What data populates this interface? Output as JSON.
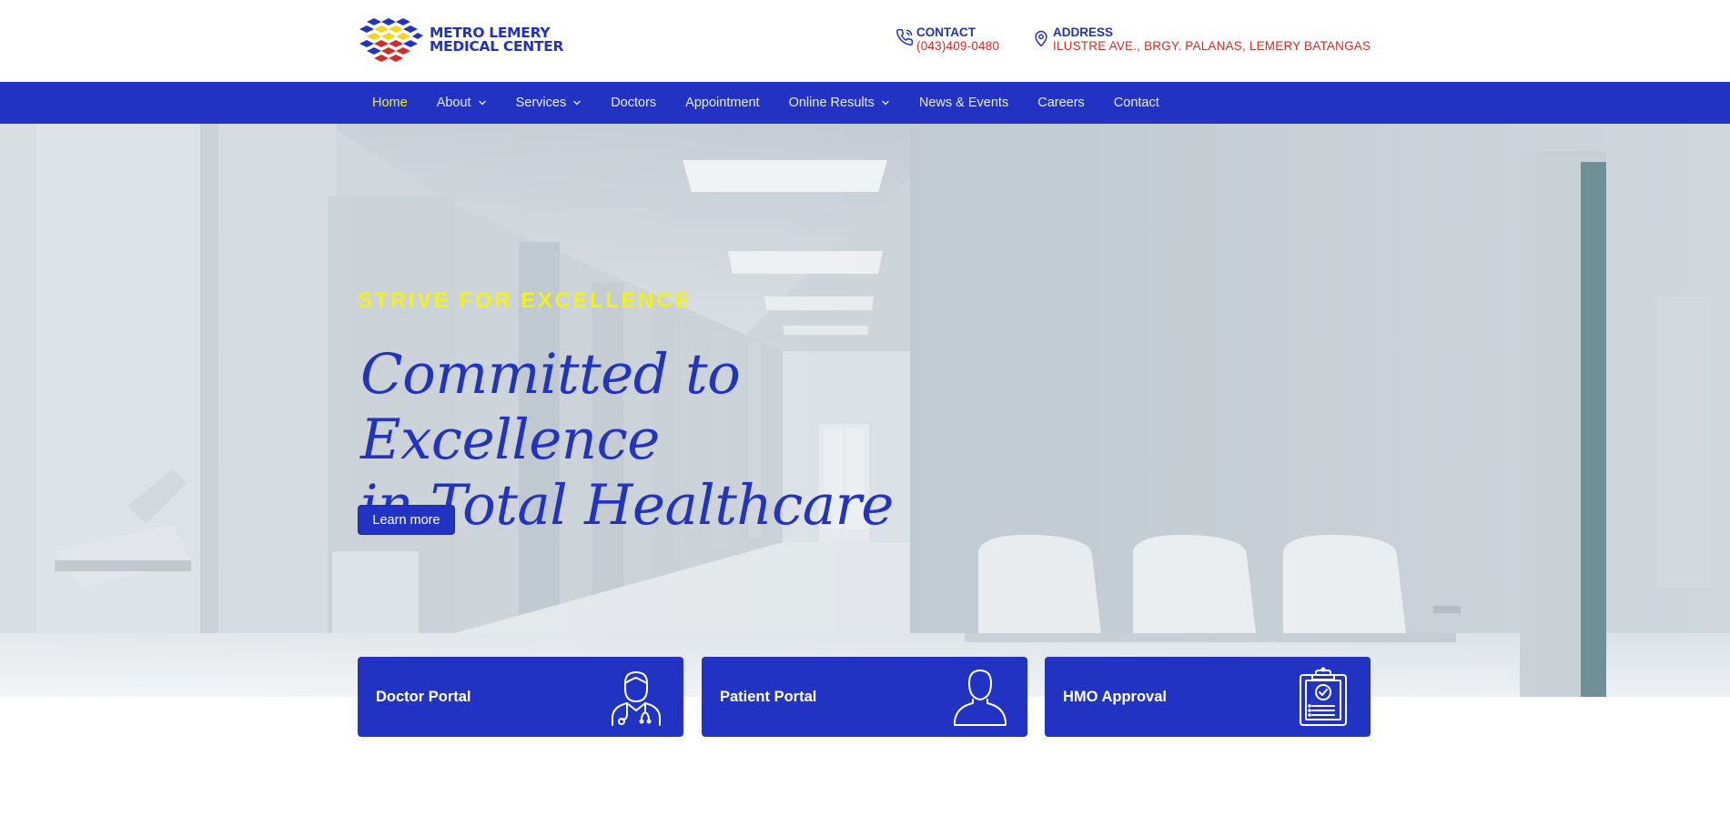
{
  "header": {
    "logo_line1": "METRO LEMERY",
    "logo_line2": "MEDICAL CENTER",
    "contact": {
      "label": "CONTACT",
      "value": "(043)409-0480"
    },
    "address": {
      "label": "ADDRESS",
      "value": "ILUSTRE AVE., BRGY. PALANAS, LEMERY BATANGAS"
    }
  },
  "nav": {
    "items": [
      {
        "label": "Home",
        "active": true,
        "dropdown": false
      },
      {
        "label": "About",
        "active": false,
        "dropdown": true
      },
      {
        "label": "Services",
        "active": false,
        "dropdown": true
      },
      {
        "label": "Doctors",
        "active": false,
        "dropdown": false
      },
      {
        "label": "Appointment",
        "active": false,
        "dropdown": false
      },
      {
        "label": "Online Results",
        "active": false,
        "dropdown": true
      },
      {
        "label": "News & Events",
        "active": false,
        "dropdown": false
      },
      {
        "label": "Careers",
        "active": false,
        "dropdown": false
      },
      {
        "label": "Contact",
        "active": false,
        "dropdown": false
      }
    ]
  },
  "hero": {
    "eyebrow": "STRIVE FOR EXCELLENCE",
    "title_line1": "Committed to Excellence",
    "title_line2": "in Total Healthcare",
    "button_label": "Learn more"
  },
  "cards": [
    {
      "label": "Doctor Portal",
      "icon": "doctor-icon"
    },
    {
      "label": "Patient Portal",
      "icon": "user-icon"
    },
    {
      "label": "HMO Approval",
      "icon": "clipboard-check-icon"
    }
  ],
  "colors": {
    "brand_blue": "#2233c4",
    "accent_yellow": "#f3f315",
    "accent_red": "#d42a2a",
    "white": "#ffffff"
  }
}
